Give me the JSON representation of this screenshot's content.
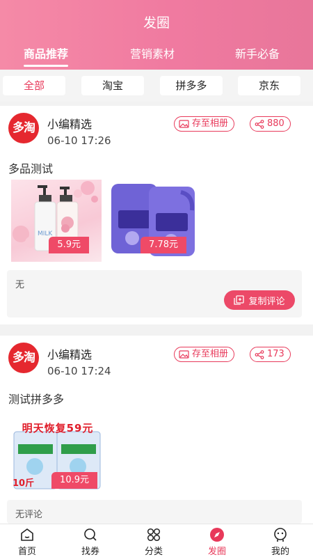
{
  "header": {
    "title": "发圈",
    "tabs": [
      {
        "label": "商品推荐",
        "active": true
      },
      {
        "label": "营销素材",
        "active": false
      },
      {
        "label": "新手必备",
        "active": false
      }
    ]
  },
  "filters": [
    {
      "label": "全部",
      "active": true
    },
    {
      "label": "淘宝",
      "active": false
    },
    {
      "label": "拼多多",
      "active": false
    },
    {
      "label": "京东",
      "active": false
    }
  ],
  "posts": [
    {
      "logo_text": "多淘",
      "author": "小编精选",
      "time": "06-10 17:26",
      "save_label": "存至相册",
      "share_count": "880",
      "text": "多品测试",
      "products": [
        {
          "price": "5.9元",
          "image": "lotion-bottles"
        },
        {
          "price": "7.78元",
          "image": "laundry-detergent"
        }
      ],
      "comment": "无",
      "copy_label": "复制评论"
    },
    {
      "logo_text": "多淘",
      "author": "小编精选",
      "time": "06-10 17:24",
      "save_label": "存至相册",
      "share_count": "173",
      "text": "测试拼多多",
      "products": [
        {
          "price": "10.9元",
          "image": "washing-powder",
          "banner_text": "明天恢复59元",
          "weight_text": "10斤"
        }
      ],
      "comment": "无评论"
    }
  ],
  "bottom_nav": [
    {
      "label": "首页",
      "icon": "home-icon"
    },
    {
      "label": "找券",
      "icon": "search-icon"
    },
    {
      "label": "分类",
      "icon": "category-icon"
    },
    {
      "label": "发圈",
      "icon": "compass-icon",
      "active": true
    },
    {
      "label": "我的",
      "icon": "profile-icon"
    }
  ],
  "colors": {
    "accent": "#e8395a",
    "header_gradient_start": "#f58aa7",
    "header_gradient_end": "#e8769a",
    "logo_red": "#e5282f"
  }
}
